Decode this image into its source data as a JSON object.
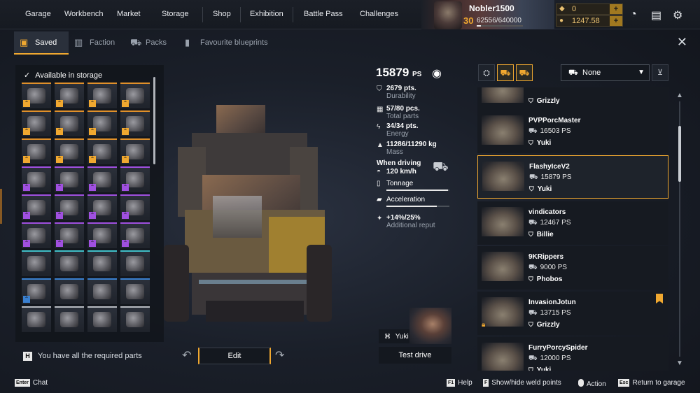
{
  "topnav": {
    "items": [
      "Garage",
      "Workbench",
      "Market",
      "Storage",
      "Shop",
      "Exhibition",
      "Battle Pass",
      "Challenges"
    ]
  },
  "profile": {
    "name": "Nobler1500",
    "level": "30",
    "xp": "62556/640000",
    "xp_progress": 0.098,
    "currency_1": "0",
    "currency_2": "1247.58"
  },
  "tabs": [
    "Saved",
    "Faction",
    "Packs",
    "Favourite blueprints"
  ],
  "storage": {
    "header": "Available in storage",
    "rarity_rows": [
      "orange",
      "orange",
      "orange",
      "purple",
      "purple",
      "purple",
      "teal",
      "blue",
      "white"
    ],
    "required_key": "H",
    "required_text": "You have all the required parts"
  },
  "editor": {
    "edit_label": "Edit"
  },
  "stats": {
    "ps_value": "15879",
    "ps_unit": "PS",
    "durability_value": "2679 pts.",
    "durability_label": "Durability",
    "parts_value": "57/80 pcs.",
    "parts_label": "Total parts",
    "energy_value": "34/34 pts.",
    "energy_label": "Energy",
    "mass_value": "11286/11290 kg",
    "mass_label": "Mass",
    "driving_label": "When driving",
    "speed_value": "120 km/h",
    "tonnage_label": "Tonnage",
    "tonnage_level": 0.98,
    "accel_label": "Acceleration",
    "accel_level": 0.8,
    "reput_value": "+14%/25%",
    "reput_label": "Additional reput"
  },
  "pilot": {
    "name": "Yuki",
    "test_drive": "Test drive"
  },
  "filters": {
    "select_value": "None"
  },
  "builds": [
    {
      "name": "",
      "ps": "",
      "pilot": "Grizzly",
      "fav": false,
      "locked": false,
      "selected": false,
      "partial": true
    },
    {
      "name": "PVPPorcMaster",
      "ps": "16503 PS",
      "pilot": "Yuki",
      "fav": false,
      "locked": false,
      "selected": false
    },
    {
      "name": "FlashyIceV2",
      "ps": "15879 PS",
      "pilot": "Yuki",
      "fav": false,
      "locked": false,
      "selected": true
    },
    {
      "name": "vindicators",
      "ps": "12467 PS",
      "pilot": "Billie",
      "fav": false,
      "locked": false,
      "selected": false
    },
    {
      "name": "9KRippers",
      "ps": "9000 PS",
      "pilot": "Phobos",
      "fav": false,
      "locked": false,
      "selected": false
    },
    {
      "name": "InvasionJotun",
      "ps": "13715 PS",
      "pilot": "Grizzly",
      "fav": true,
      "locked": true,
      "selected": false
    },
    {
      "name": "FurryPorcySpider",
      "ps": "12000 PS",
      "pilot": "Yuki",
      "fav": false,
      "locked": false,
      "selected": false
    }
  ],
  "footer": {
    "chat_key": "Enter",
    "chat": "Chat",
    "help_key": "F1",
    "help": "Help",
    "weld_key": "F",
    "weld": "Show/hide weld points",
    "action": "Action",
    "return_key": "Esc",
    "return": "Return to garage"
  },
  "colors": {
    "accent": "#f0a830",
    "epic": "#a050e0",
    "teal": "#40c0c8",
    "blue": "#3a80d0"
  }
}
